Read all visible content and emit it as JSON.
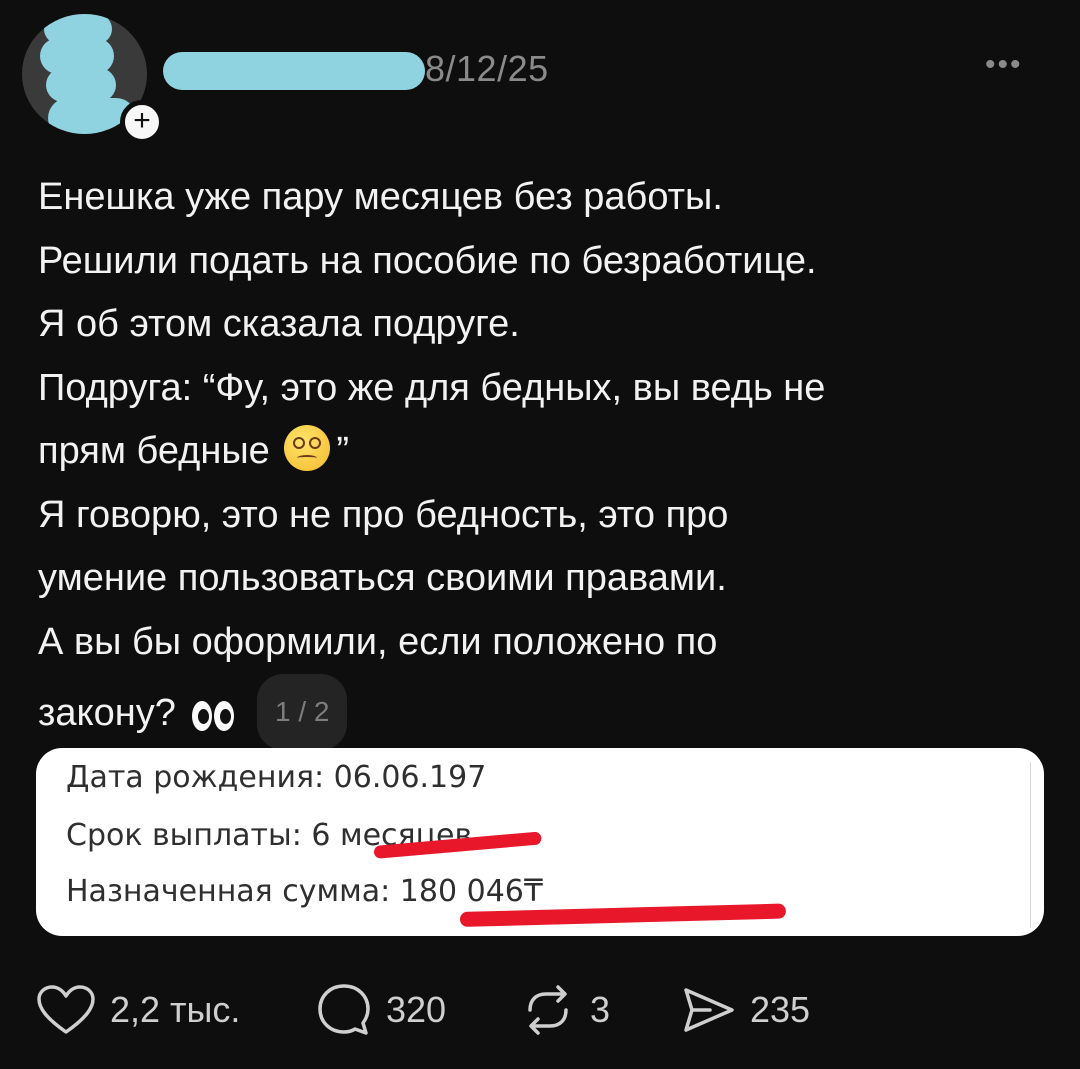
{
  "header": {
    "date": "8/12/25",
    "more": "•••",
    "follow": "+"
  },
  "post": {
    "lines": [
      "Енешка уже пару месяцев без работы.",
      "Решили подать на пособие по безработице.",
      "Я об этом сказала подруге.",
      "Подруга: “Фу, это же для бедных, вы ведь не",
      "прям бедные",
      "”",
      "Я говорю, это не про бедность, это про",
      "умение пользоваться своими правами.",
      "А вы бы оформили, если положено по",
      "закону?"
    ],
    "page_indicator": "1 / 2"
  },
  "attachment": {
    "birth_date": "Дата рождения: 06.06.197",
    "payment_term": "Срок выплаты: 6 месяцев",
    "amount": "Назначенная сумма: 180 046₸"
  },
  "actions": {
    "likes": "2,2 тыс.",
    "comments": "320",
    "reposts": "3",
    "shares": "235"
  },
  "colors": {
    "background": "#0e0e0e",
    "redaction": "#8ed3df",
    "underline": "#e8182a"
  }
}
